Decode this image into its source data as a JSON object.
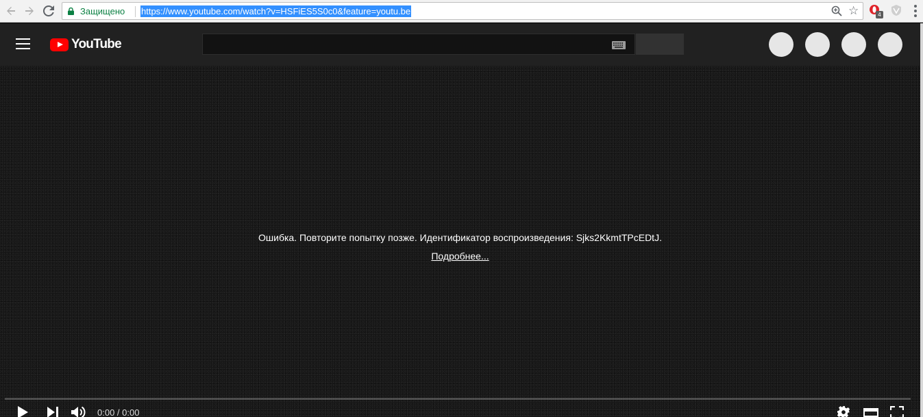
{
  "browser": {
    "secure_label": "Защищено",
    "url": "https://www.youtube.com/watch?v=HSFiES5S0c0&feature=youtu.be",
    "extension_badge": "4"
  },
  "youtube": {
    "logo_text": "YouTube"
  },
  "player": {
    "error_message": "Ошибка. Повторите попытку позже. Идентификатор воспроизведения: Sjks2KkmtTPcEDtJ.",
    "learn_more": "Подробнее...",
    "time": "0:00 / 0:00",
    "progress": 0
  },
  "colors": {
    "youtube_red": "#ff0000",
    "header_bg": "#212121",
    "url_highlight": "#3390ff",
    "secure_green": "#0b8043"
  }
}
